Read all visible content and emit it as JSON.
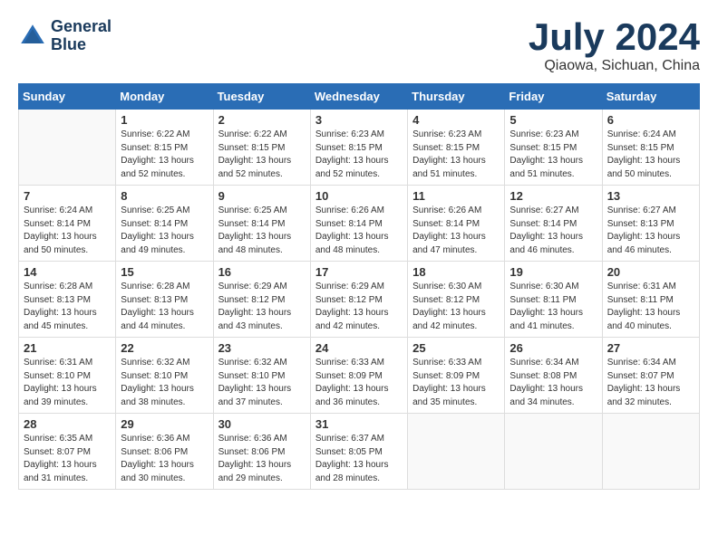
{
  "header": {
    "logo": {
      "line1": "General",
      "line2": "Blue"
    },
    "month": "July 2024",
    "location": "Qiaowa, Sichuan, China"
  },
  "days_of_week": [
    "Sunday",
    "Monday",
    "Tuesday",
    "Wednesday",
    "Thursday",
    "Friday",
    "Saturday"
  ],
  "weeks": [
    [
      {
        "day": "",
        "info": ""
      },
      {
        "day": "1",
        "info": "Sunrise: 6:22 AM\nSunset: 8:15 PM\nDaylight: 13 hours\nand 52 minutes."
      },
      {
        "day": "2",
        "info": "Sunrise: 6:22 AM\nSunset: 8:15 PM\nDaylight: 13 hours\nand 52 minutes."
      },
      {
        "day": "3",
        "info": "Sunrise: 6:23 AM\nSunset: 8:15 PM\nDaylight: 13 hours\nand 52 minutes."
      },
      {
        "day": "4",
        "info": "Sunrise: 6:23 AM\nSunset: 8:15 PM\nDaylight: 13 hours\nand 51 minutes."
      },
      {
        "day": "5",
        "info": "Sunrise: 6:23 AM\nSunset: 8:15 PM\nDaylight: 13 hours\nand 51 minutes."
      },
      {
        "day": "6",
        "info": "Sunrise: 6:24 AM\nSunset: 8:15 PM\nDaylight: 13 hours\nand 50 minutes."
      }
    ],
    [
      {
        "day": "7",
        "info": "Sunrise: 6:24 AM\nSunset: 8:14 PM\nDaylight: 13 hours\nand 50 minutes."
      },
      {
        "day": "8",
        "info": "Sunrise: 6:25 AM\nSunset: 8:14 PM\nDaylight: 13 hours\nand 49 minutes."
      },
      {
        "day": "9",
        "info": "Sunrise: 6:25 AM\nSunset: 8:14 PM\nDaylight: 13 hours\nand 48 minutes."
      },
      {
        "day": "10",
        "info": "Sunrise: 6:26 AM\nSunset: 8:14 PM\nDaylight: 13 hours\nand 48 minutes."
      },
      {
        "day": "11",
        "info": "Sunrise: 6:26 AM\nSunset: 8:14 PM\nDaylight: 13 hours\nand 47 minutes."
      },
      {
        "day": "12",
        "info": "Sunrise: 6:27 AM\nSunset: 8:14 PM\nDaylight: 13 hours\nand 46 minutes."
      },
      {
        "day": "13",
        "info": "Sunrise: 6:27 AM\nSunset: 8:13 PM\nDaylight: 13 hours\nand 46 minutes."
      }
    ],
    [
      {
        "day": "14",
        "info": "Sunrise: 6:28 AM\nSunset: 8:13 PM\nDaylight: 13 hours\nand 45 minutes."
      },
      {
        "day": "15",
        "info": "Sunrise: 6:28 AM\nSunset: 8:13 PM\nDaylight: 13 hours\nand 44 minutes."
      },
      {
        "day": "16",
        "info": "Sunrise: 6:29 AM\nSunset: 8:12 PM\nDaylight: 13 hours\nand 43 minutes."
      },
      {
        "day": "17",
        "info": "Sunrise: 6:29 AM\nSunset: 8:12 PM\nDaylight: 13 hours\nand 42 minutes."
      },
      {
        "day": "18",
        "info": "Sunrise: 6:30 AM\nSunset: 8:12 PM\nDaylight: 13 hours\nand 42 minutes."
      },
      {
        "day": "19",
        "info": "Sunrise: 6:30 AM\nSunset: 8:11 PM\nDaylight: 13 hours\nand 41 minutes."
      },
      {
        "day": "20",
        "info": "Sunrise: 6:31 AM\nSunset: 8:11 PM\nDaylight: 13 hours\nand 40 minutes."
      }
    ],
    [
      {
        "day": "21",
        "info": "Sunrise: 6:31 AM\nSunset: 8:10 PM\nDaylight: 13 hours\nand 39 minutes."
      },
      {
        "day": "22",
        "info": "Sunrise: 6:32 AM\nSunset: 8:10 PM\nDaylight: 13 hours\nand 38 minutes."
      },
      {
        "day": "23",
        "info": "Sunrise: 6:32 AM\nSunset: 8:10 PM\nDaylight: 13 hours\nand 37 minutes."
      },
      {
        "day": "24",
        "info": "Sunrise: 6:33 AM\nSunset: 8:09 PM\nDaylight: 13 hours\nand 36 minutes."
      },
      {
        "day": "25",
        "info": "Sunrise: 6:33 AM\nSunset: 8:09 PM\nDaylight: 13 hours\nand 35 minutes."
      },
      {
        "day": "26",
        "info": "Sunrise: 6:34 AM\nSunset: 8:08 PM\nDaylight: 13 hours\nand 34 minutes."
      },
      {
        "day": "27",
        "info": "Sunrise: 6:34 AM\nSunset: 8:07 PM\nDaylight: 13 hours\nand 32 minutes."
      }
    ],
    [
      {
        "day": "28",
        "info": "Sunrise: 6:35 AM\nSunset: 8:07 PM\nDaylight: 13 hours\nand 31 minutes."
      },
      {
        "day": "29",
        "info": "Sunrise: 6:36 AM\nSunset: 8:06 PM\nDaylight: 13 hours\nand 30 minutes."
      },
      {
        "day": "30",
        "info": "Sunrise: 6:36 AM\nSunset: 8:06 PM\nDaylight: 13 hours\nand 29 minutes."
      },
      {
        "day": "31",
        "info": "Sunrise: 6:37 AM\nSunset: 8:05 PM\nDaylight: 13 hours\nand 28 minutes."
      },
      {
        "day": "",
        "info": ""
      },
      {
        "day": "",
        "info": ""
      },
      {
        "day": "",
        "info": ""
      }
    ]
  ]
}
